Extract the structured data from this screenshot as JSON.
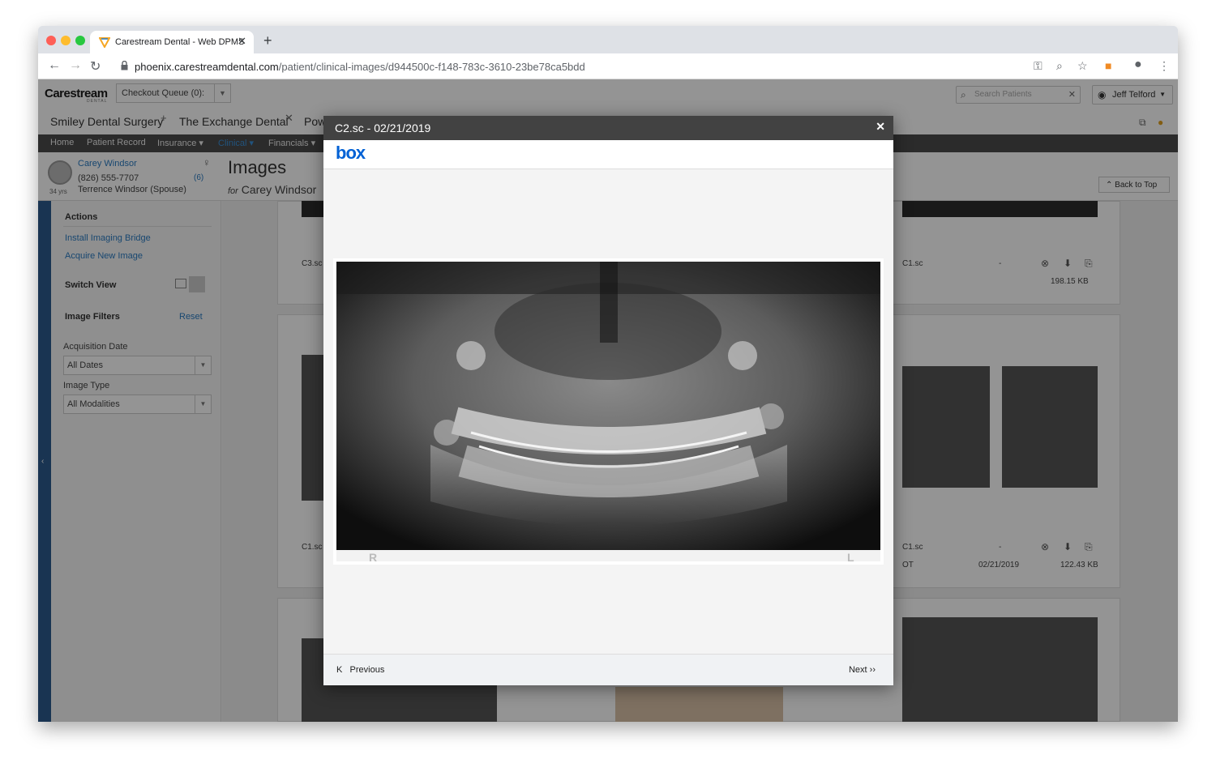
{
  "browser": {
    "tab_title": "Carestream Dental - Web DPMS",
    "url_host": "phoenix.carestreamdental.com",
    "url_path": "/patient/clinical-images/d944500c-f148-783c-3610-23be78ca5bdd"
  },
  "header": {
    "brand": "Carestream",
    "brand_sub": "DENTAL",
    "checkout_queue": "Checkout Queue (0):",
    "search_placeholder": "Search Patients",
    "user_name": "Jeff Telford",
    "practice_tabs": [
      "Smiley Dental Surgery",
      "The Exchange Dental",
      "Pow"
    ]
  },
  "main_nav": {
    "items": [
      "Home",
      "Patient Record",
      "Insurance ▾",
      "Clinical ▾",
      "Financials ▾"
    ],
    "active": "Clinical"
  },
  "patient": {
    "name": "Carey Windsor",
    "phone": "(826) 555-7707",
    "spouse": "Terrence Windsor (Spouse)",
    "age": "34 yrs",
    "count": "(6)"
  },
  "page": {
    "title": "Images",
    "subtitle_prefix": "for",
    "subtitle_name": "Carey Windsor",
    "back_to_top": "Back to Top"
  },
  "sidebar": {
    "actions_heading": "Actions",
    "install_link": "Install Imaging Bridge",
    "acquire_link": "Acquire New Image",
    "switch_view": "Switch View",
    "filters_heading": "Image Filters",
    "reset": "Reset",
    "acq_date_label": "Acquisition Date",
    "acq_date_value": "All Dates",
    "image_type_label": "Image Type",
    "image_type_value": "All Modalities"
  },
  "gallery": {
    "cap_left_1": "C3.sc",
    "cap_right_1": "C1.sc",
    "dash_1": "-",
    "size_1": "198.15 KB",
    "cap_left_2": "C1.sc",
    "cap_right_2": "C1.sc",
    "dash_2": "-",
    "type_2": "OT",
    "date_2": "02/21/2019",
    "size_2": "122.43 KB"
  },
  "modal": {
    "title": "C2.sc - 02/21/2019",
    "box_logo": "box",
    "xray_left_marker": "R",
    "xray_right_marker": "L",
    "previous": "Previous",
    "next": "Next"
  },
  "colors": {
    "brand_blue": "#2a7bc2",
    "box_blue": "#0061d5",
    "modal_header": "#424242",
    "sidebar_edge": "#2c5b8e"
  }
}
